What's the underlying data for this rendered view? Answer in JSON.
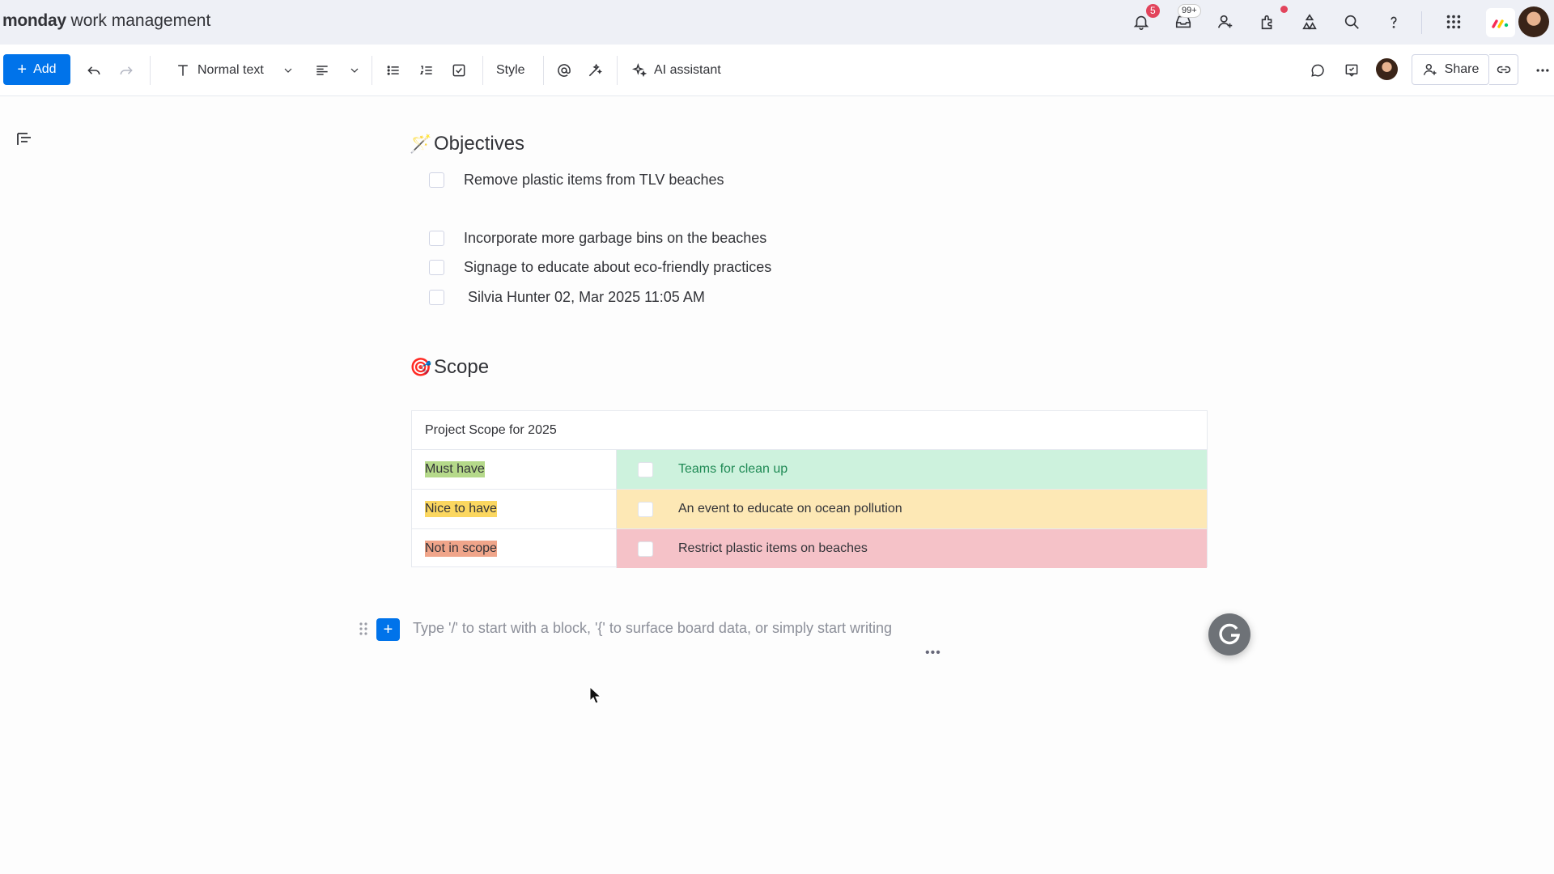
{
  "app": {
    "brand_bold": "monday",
    "brand_rest": " work management",
    "notifications_count": "5",
    "inbox_count": "99+"
  },
  "toolbar": {
    "add_label": "Add",
    "text_style_label": "Normal text",
    "style_label": "Style",
    "ai_label": "AI assistant",
    "share_label": "Share"
  },
  "document": {
    "objectives": {
      "emoji": "🪄",
      "title": "Objectives",
      "items": [
        "Remove plastic items from TLV beaches",
        "Incorporate more garbage bins on the beaches",
        "Signage to educate about eco-friendly practices",
        "Silvia Hunter 02, Mar 2025 11:05 AM"
      ]
    },
    "scope": {
      "emoji": "🎯",
      "title": "Scope",
      "table_caption": "Project Scope for 2025",
      "rows": [
        {
          "tag": "Must have",
          "item": "Teams for clean up",
          "tag_color": "#b5d98a",
          "row_color": "#cdf2dd",
          "text_color": "#1f8a55"
        },
        {
          "tag": "Nice to have",
          "item": "An event to educate on ocean pollution",
          "tag_color": "#fbd760",
          "row_color": "#fde8b5",
          "text_color": "#323338"
        },
        {
          "tag": "Not in scope",
          "item": "Restrict plastic items on beaches",
          "tag_color": "#f0a58a",
          "row_color": "#f5c2c8",
          "text_color": "#323338"
        }
      ]
    },
    "placeholder": "Type '/' to start with a block, '{' to surface board data, or simply start writing"
  },
  "icons": {
    "topbar": [
      "bell-icon",
      "inbox-icon",
      "invite-members-icon",
      "apps-icon",
      "workflows-icon",
      "search-icon",
      "help-icon",
      "app-switcher-icon"
    ],
    "toolbar": [
      "undo-icon",
      "redo-icon",
      "text-type-icon",
      "chevron-down-icon",
      "align-left-icon",
      "bulleted-list-icon",
      "numbered-list-icon",
      "checklist-icon",
      "mention-icon",
      "magic-icon",
      "ai-sparkle-icon",
      "comment-icon",
      "updates-icon",
      "share-person-icon",
      "link-icon",
      "more-icon"
    ]
  }
}
